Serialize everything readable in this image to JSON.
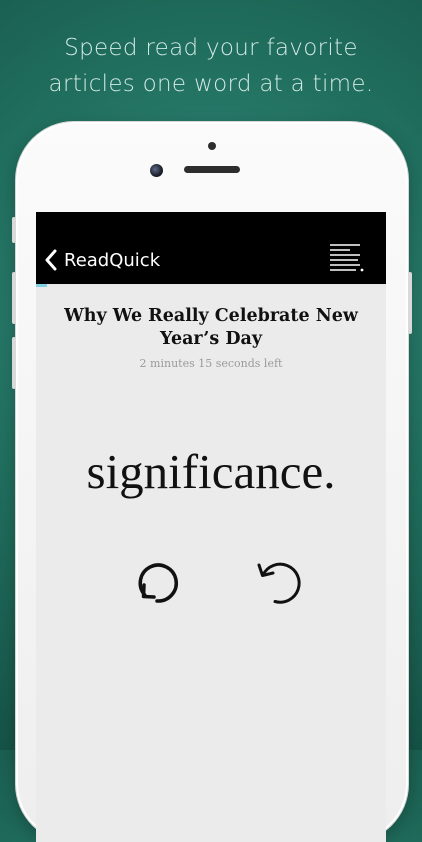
{
  "tagline": {
    "line1": "Speed read your favorite",
    "line2": "articles one word at a time."
  },
  "app": {
    "nav": {
      "back_label": "ReadQuick",
      "back_icon": "chevron-left-icon",
      "menu_icon": "text-lines-icon"
    },
    "reading_progress": 0.03,
    "article": {
      "title": "Why We Really Celebrate New Year’s Day",
      "time_left": "2 minutes 15 seconds left",
      "current_word": "significance."
    },
    "controls": {
      "play_icon": "circular-replay-icon",
      "rewind_icon": "rewind-arrow-icon"
    }
  },
  "colors": {
    "background": "#21705f",
    "tagline_text": "#d2e9e3",
    "navbar": "#000000",
    "reader_background": "#ebebeb",
    "progress_accent": "#7fd0e0"
  }
}
